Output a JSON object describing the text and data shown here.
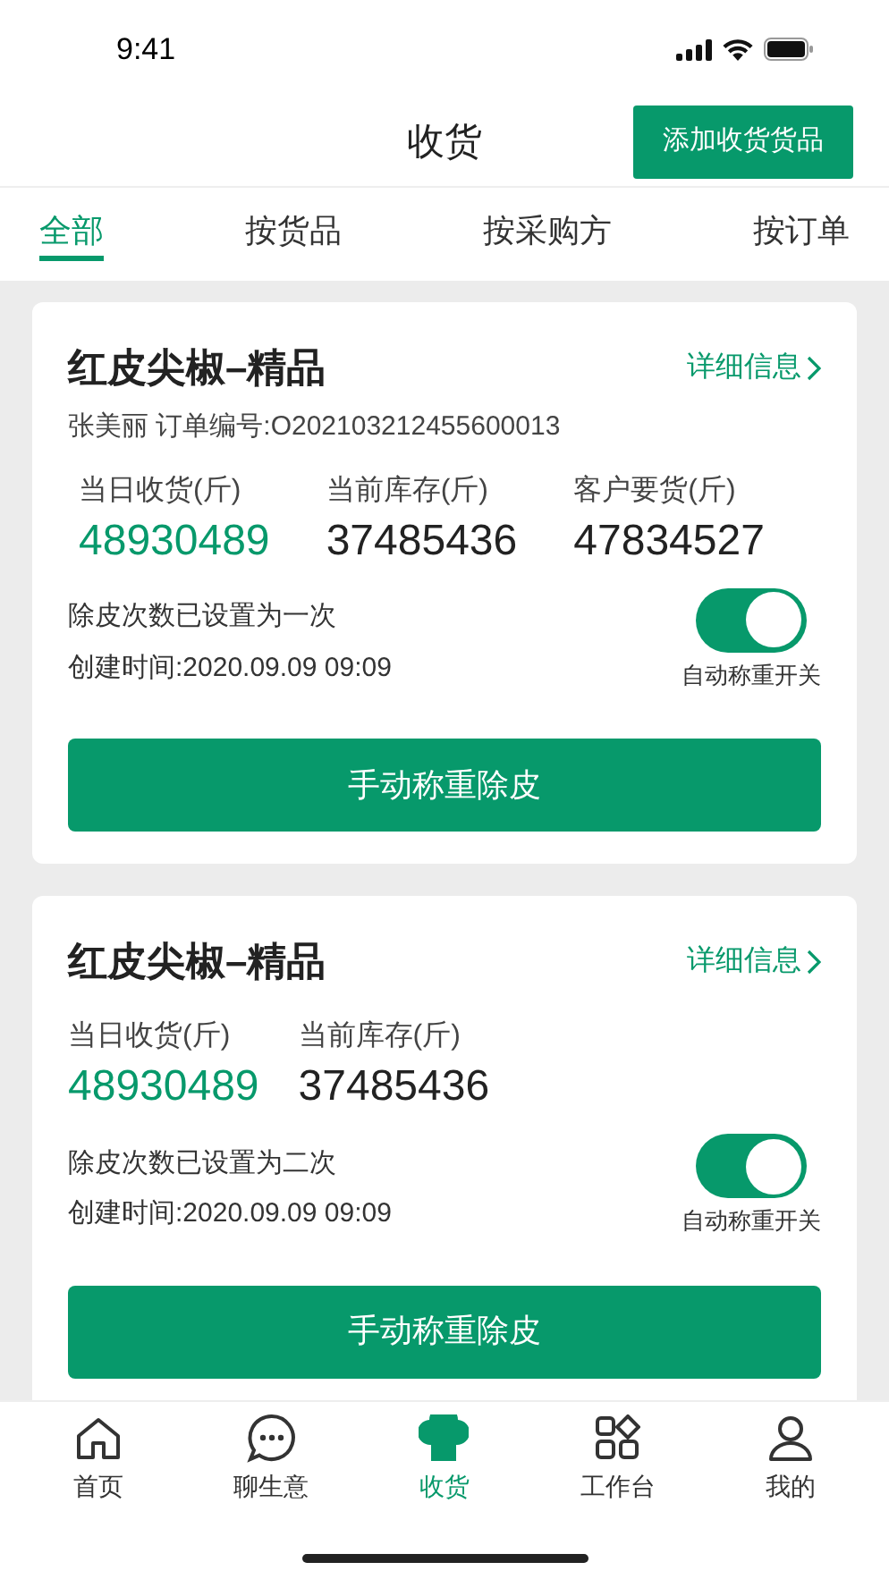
{
  "status_bar": {
    "time": "9:41"
  },
  "header": {
    "title": "收货",
    "action": "添加收货货品"
  },
  "tabs": [
    {
      "label": "全部",
      "selected": true
    },
    {
      "label": "按货品",
      "selected": false
    },
    {
      "label": "按采购方",
      "selected": false
    },
    {
      "label": "按订单",
      "selected": false
    }
  ],
  "cards": [
    {
      "title": "红皮尖椒–精品",
      "detail_link": "详细信息",
      "buyer_line": "张美丽 订单编号:O202103212455600013",
      "stats": [
        {
          "label": "当日收货(斤)",
          "value": "48930489",
          "highlighted": true
        },
        {
          "label": "当前库存(斤)",
          "value": "37485436",
          "highlighted": false
        },
        {
          "label": "客户要货(斤)",
          "value": "47834527",
          "highlighted": false
        }
      ],
      "tare_note": "除皮次数已设置为一次",
      "created": "创建时间:2020.09.09 09:09",
      "toggle": {
        "label": "自动称重开关",
        "on": true
      },
      "button": "手动称重除皮"
    },
    {
      "title": "红皮尖椒–精品",
      "detail_link": "详细信息",
      "stats": [
        {
          "label": "当日收货(斤)",
          "value": "48930489",
          "highlighted": true
        },
        {
          "label": "当前库存(斤)",
          "value": "37485436",
          "highlighted": false
        }
      ],
      "tare_note": "除皮次数已设置为二次",
      "created": "创建时间:2020.09.09 09:09",
      "toggle": {
        "label": "自动称重开关",
        "on": true
      },
      "button": "手动称重除皮"
    }
  ],
  "tab_bar": [
    {
      "label": "首页",
      "kind": "home",
      "selected": false
    },
    {
      "label": "聊生意",
      "kind": "chat",
      "selected": false
    },
    {
      "label": "收货",
      "kind": "receive",
      "selected": true
    },
    {
      "label": "工作台",
      "kind": "workbench",
      "selected": false
    },
    {
      "label": "我的",
      "kind": "profile",
      "selected": false
    }
  ]
}
